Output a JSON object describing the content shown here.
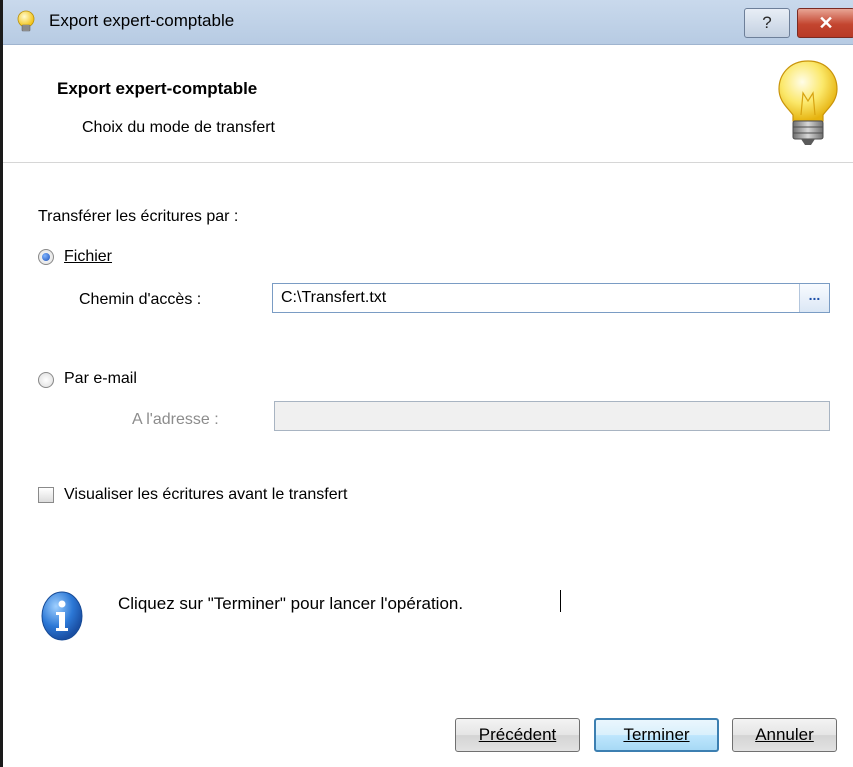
{
  "window": {
    "title": "Export expert-comptable",
    "help_label": "?",
    "close_label": "✕"
  },
  "header": {
    "title": "Export expert-comptable",
    "subtitle": "Choix du mode de transfert"
  },
  "form": {
    "transfer_label": "Transférer les écritures par :",
    "file_option": {
      "label": "Fichier",
      "selected": true
    },
    "path_label": "Chemin d'accès :",
    "path_value": "C:\\Transfert.txt",
    "browse_label": "...",
    "email_option": {
      "label": "Par e-mail",
      "selected": false
    },
    "address_label": "A l'adresse :",
    "address_value": "",
    "preview_checkbox": {
      "label": "Visualiser les écritures avant le transfert",
      "checked": false
    }
  },
  "info": {
    "message": "Cliquez sur \"Terminer\" pour lancer l'opération."
  },
  "buttons": {
    "previous": "Précédent",
    "finish": "Terminer",
    "cancel": "Annuler"
  },
  "icons": {
    "title": "lightbulb-icon",
    "header": "lightbulb-icon",
    "info": "info-icon"
  },
  "colors": {
    "titlebar": "#c9d9ec",
    "close": "#c3452f",
    "default_button_border": "#3c7fb1"
  }
}
